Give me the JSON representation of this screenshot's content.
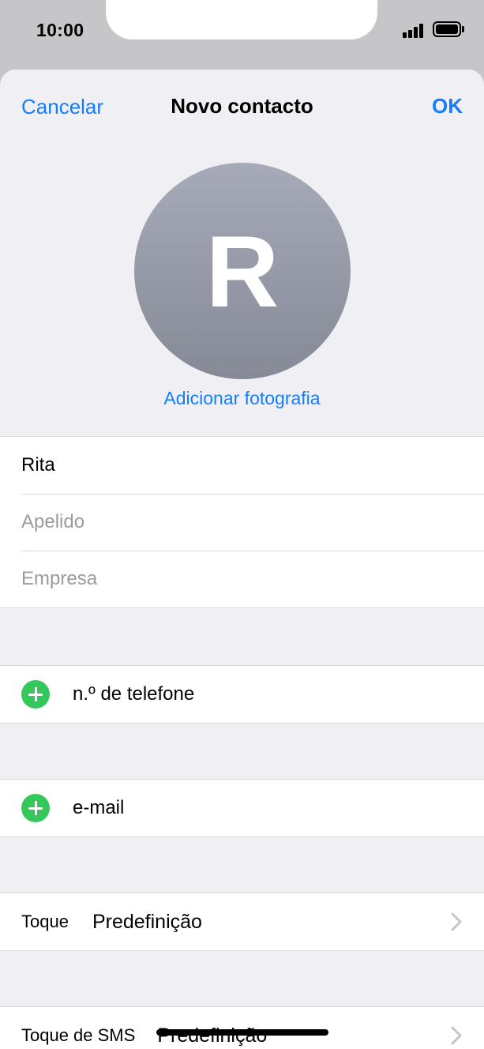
{
  "status_bar": {
    "time": "10:00"
  },
  "nav": {
    "cancel_label": "Cancelar",
    "title": "Novo contacto",
    "ok_label": "OK"
  },
  "avatar": {
    "initial": "R",
    "add_photo_label": "Adicionar fotografia"
  },
  "name_fields": {
    "first_name_value": "Rita",
    "last_name_placeholder": "Apelido",
    "company_placeholder": "Empresa"
  },
  "add_phone_label": "n.º de telefone",
  "add_email_label": "e-mail",
  "ringtone": {
    "label": "Toque",
    "value": "Predefinição"
  },
  "sms_tone": {
    "label": "Toque de SMS",
    "value": "Predefinição"
  },
  "colors": {
    "accent": "#157efb",
    "add_green": "#34c759",
    "background": "#efeff4",
    "placeholder": "#9a9aa0"
  }
}
